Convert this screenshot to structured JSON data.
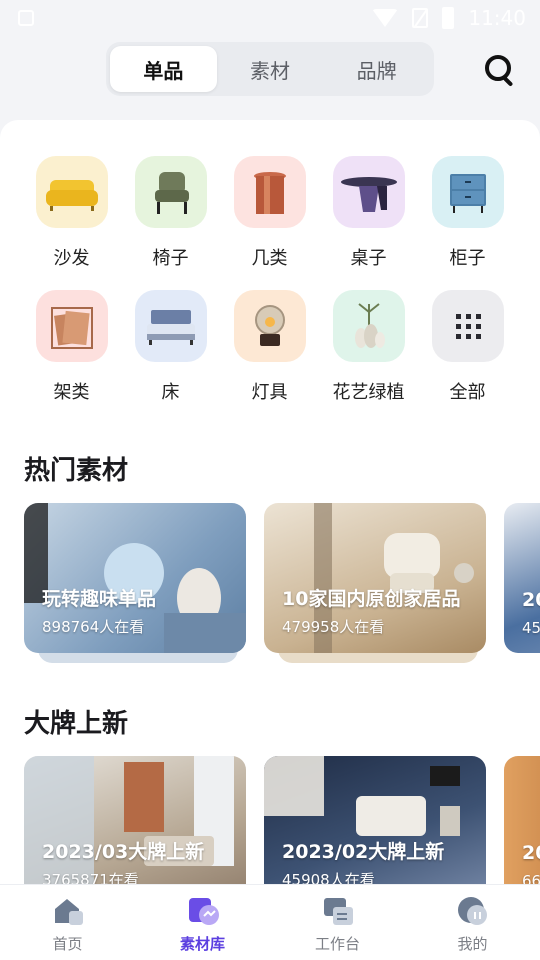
{
  "status_bar": {
    "time": "11:40"
  },
  "top_tabs": [
    {
      "label": "单品",
      "active": true
    },
    {
      "label": "素材",
      "active": false
    },
    {
      "label": "品牌",
      "active": false
    }
  ],
  "search": {
    "icon": "search-icon"
  },
  "categories": [
    {
      "label": "沙发",
      "icon": "sofa-icon",
      "bg": "#fbf0cf"
    },
    {
      "label": "椅子",
      "icon": "chair-icon",
      "bg": "#e6f4dd"
    },
    {
      "label": "几类",
      "icon": "side-table-icon",
      "bg": "#fde3e0"
    },
    {
      "label": "桌子",
      "icon": "table-icon",
      "bg": "#efe1f7"
    },
    {
      "label": "柜子",
      "icon": "cabinet-icon",
      "bg": "#d9f0f4"
    },
    {
      "label": "架类",
      "icon": "shelf-icon",
      "bg": "#fde0de"
    },
    {
      "label": "床",
      "icon": "bed-icon",
      "bg": "#e2eaf8"
    },
    {
      "label": "灯具",
      "icon": "lamp-icon",
      "bg": "#fde8d4"
    },
    {
      "label": "花艺绿植",
      "icon": "plant-icon",
      "bg": "#dff4ea"
    },
    {
      "label": "全部",
      "icon": "grid-icon",
      "bg": "#ececef"
    }
  ],
  "sections": {
    "hot_materials": {
      "title": "热门素材",
      "cards": [
        {
          "title": "玩转趣味单品",
          "subtitle": "898764人在看",
          "colors": [
            "#9fb8cf",
            "#6f8fae"
          ]
        },
        {
          "title": "10家国内原创家居品",
          "subtitle": "479958人在看",
          "colors": [
            "#e2d3bd",
            "#b89c74"
          ]
        },
        {
          "title": "20",
          "subtitle": "45",
          "colors": [
            "#4a6fa0",
            "#9aaec8"
          ]
        }
      ]
    },
    "brand_new": {
      "title": "大牌上新",
      "cards": [
        {
          "title": "2023/03大牌上新",
          "subtitle": "3765871在看",
          "colors": [
            "#cfc7bb",
            "#8d7a68"
          ]
        },
        {
          "title": "2023/02大牌上新",
          "subtitle": "45908人在看",
          "colors": [
            "#2d3d5a",
            "#6a7da0"
          ]
        },
        {
          "title": "20",
          "subtitle": "66",
          "colors": [
            "#c7803c",
            "#8a5a34"
          ]
        }
      ]
    }
  },
  "bottom_nav": [
    {
      "label": "首页",
      "icon": "home-icon",
      "active": false
    },
    {
      "label": "素材库",
      "icon": "library-icon",
      "active": true
    },
    {
      "label": "工作台",
      "icon": "workbench-icon",
      "active": false
    },
    {
      "label": "我的",
      "icon": "profile-icon",
      "active": false
    }
  ],
  "colors": {
    "accent": "#5b3fe0",
    "background": "#f3f4f7"
  }
}
